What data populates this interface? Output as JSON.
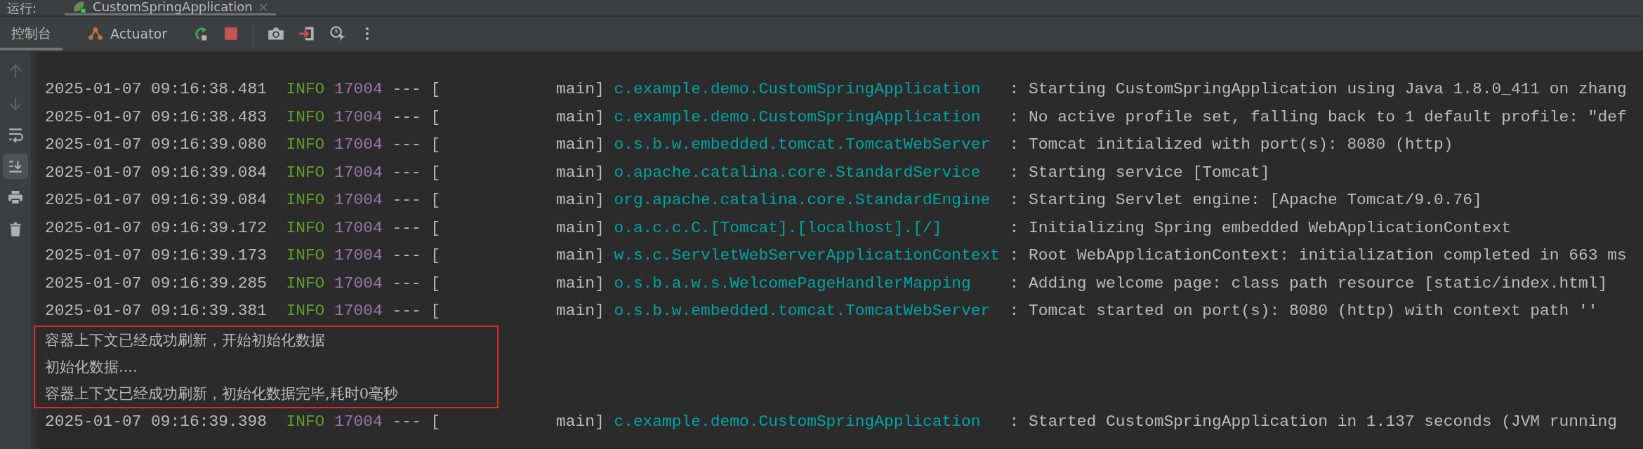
{
  "run_bar": {
    "label": "运行:",
    "tab": {
      "title": "CustomSpringApplication",
      "close": "×",
      "selected": true
    }
  },
  "toolbar": {
    "tabs": [
      {
        "label": "控制台",
        "selected": true,
        "kind": "console"
      },
      {
        "label": "Actuator",
        "selected": false,
        "kind": "actuator"
      }
    ],
    "actions": [
      {
        "kind": "rerun"
      },
      {
        "kind": "stop"
      },
      {
        "kind": "divider"
      },
      {
        "kind": "camera"
      },
      {
        "kind": "exit"
      },
      {
        "kind": "clock"
      },
      {
        "kind": "more"
      }
    ]
  },
  "side_tools": [
    {
      "kind": "up",
      "selected": false,
      "disabled": true
    },
    {
      "kind": "down",
      "selected": false,
      "disabled": true
    },
    {
      "kind": "wrap",
      "selected": false,
      "disabled": false
    },
    {
      "kind": "scroll-end",
      "selected": true,
      "disabled": false
    },
    {
      "kind": "print",
      "selected": false,
      "disabled": false
    },
    {
      "kind": "trash",
      "selected": false,
      "disabled": false
    }
  ],
  "console": {
    "lines": [
      {
        "kind": "log",
        "timestamp": "2025-01-07 09:16:38.481",
        "level": "INFO",
        "pid": "17004",
        "separator": "--- [",
        "thread": "main]",
        "logger": "c.example.demo.CustomSpringApplication",
        "message": ": Starting CustomSpringApplication using Java 1.8.0_411 on zhang"
      },
      {
        "kind": "log",
        "timestamp": "2025-01-07 09:16:38.483",
        "level": "INFO",
        "pid": "17004",
        "separator": "--- [",
        "thread": "main]",
        "logger": "c.example.demo.CustomSpringApplication",
        "message": ": No active profile set, falling back to 1 default profile: \"def"
      },
      {
        "kind": "log",
        "timestamp": "2025-01-07 09:16:39.080",
        "level": "INFO",
        "pid": "17004",
        "separator": "--- [",
        "thread": "main]",
        "logger": "o.s.b.w.embedded.tomcat.TomcatWebServer",
        "message": ": Tomcat initialized with port(s): 8080 (http)"
      },
      {
        "kind": "log",
        "timestamp": "2025-01-07 09:16:39.084",
        "level": "INFO",
        "pid": "17004",
        "separator": "--- [",
        "thread": "main]",
        "logger": "o.apache.catalina.core.StandardService",
        "message": ": Starting service [Tomcat]"
      },
      {
        "kind": "log",
        "timestamp": "2025-01-07 09:16:39.084",
        "level": "INFO",
        "pid": "17004",
        "separator": "--- [",
        "thread": "main]",
        "logger": "org.apache.catalina.core.StandardEngine",
        "message": ": Starting Servlet engine: [Apache Tomcat/9.0.76]"
      },
      {
        "kind": "log",
        "timestamp": "2025-01-07 09:16:39.172",
        "level": "INFO",
        "pid": "17004",
        "separator": "--- [",
        "thread": "main]",
        "logger": "o.a.c.c.C.[Tomcat].[localhost].[/]",
        "message": ": Initializing Spring embedded WebApplicationContext"
      },
      {
        "kind": "log",
        "timestamp": "2025-01-07 09:16:39.173",
        "level": "INFO",
        "pid": "17004",
        "separator": "--- [",
        "thread": "main]",
        "logger": "w.s.c.ServletWebServerApplicationContext",
        "message": ": Root WebApplicationContext: initialization completed in 663 ms"
      },
      {
        "kind": "log",
        "timestamp": "2025-01-07 09:16:39.285",
        "level": "INFO",
        "pid": "17004",
        "separator": "--- [",
        "thread": "main]",
        "logger": "o.s.b.a.w.s.WelcomePageHandlerMapping",
        "message": ": Adding welcome page: class path resource [static/index.html]"
      },
      {
        "kind": "log",
        "timestamp": "2025-01-07 09:16:39.381",
        "level": "INFO",
        "pid": "17004",
        "separator": "--- [",
        "thread": "main]",
        "logger": "o.s.b.w.embedded.tomcat.TomcatWebServer",
        "message": ": Tomcat started on port(s): 8080 (http) with context path ''"
      },
      {
        "kind": "highlight",
        "lines": [
          "容器上下文已经成功刷新，开始初始化数据",
          "初始化数据....",
          "容器上下文已经成功刷新，初始化数据完毕,耗时0毫秒"
        ]
      },
      {
        "kind": "log",
        "timestamp": "2025-01-07 09:16:39.398",
        "level": "INFO",
        "pid": "17004",
        "separator": "--- [",
        "thread": "main]",
        "logger": "c.example.demo.CustomSpringApplication",
        "message": ": Started CustomSpringApplication in 1.137 seconds (JVM running"
      }
    ]
  }
}
